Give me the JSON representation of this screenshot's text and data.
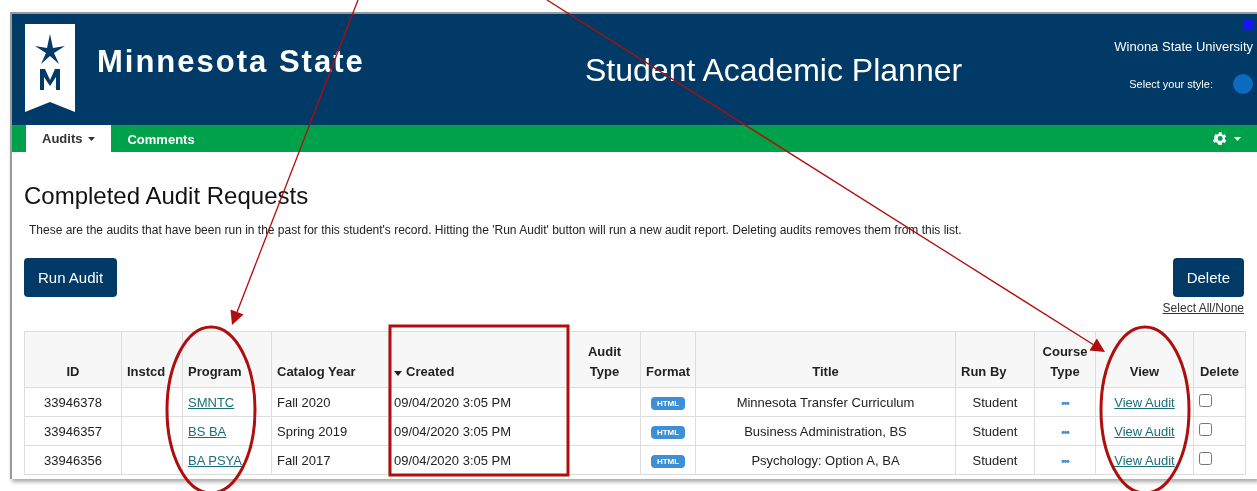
{
  "header": {
    "brand": "Minnesota State",
    "app_title": "Student Academic Planner",
    "institution": "Winona State University",
    "style_label": "Select your style:"
  },
  "nav": {
    "tabs": [
      {
        "label": "Audits",
        "selected": true,
        "dropdown": true
      },
      {
        "label": "Comments",
        "selected": false,
        "dropdown": false
      }
    ]
  },
  "page": {
    "title": "Completed Audit Requests",
    "description": "These are the audits that have been run in the past for this student's record. Hitting the 'Run Audit' button will run a new audit report. Deleting audits removes them from this list.",
    "run_button": "Run Audit",
    "delete_button": "Delete",
    "select_all_link": "Select All/None"
  },
  "table": {
    "columns": [
      {
        "label": "ID",
        "sorted": false
      },
      {
        "label": "Instcd",
        "sorted": false
      },
      {
        "label": "Program",
        "sorted": false
      },
      {
        "label": "Catalog Year",
        "sorted": false
      },
      {
        "label": "Created",
        "sorted": true
      },
      {
        "label": "Audit Type",
        "sorted": false
      },
      {
        "label": "Format",
        "sorted": false
      },
      {
        "label": "Title",
        "sorted": false
      },
      {
        "label": "Run By",
        "sorted": false
      },
      {
        "label": "Course Type",
        "sorted": false
      },
      {
        "label": "View",
        "sorted": false
      },
      {
        "label": "Delete",
        "sorted": false
      }
    ],
    "rows": [
      {
        "id": "33946378",
        "program": "SMNTC",
        "catalog_year": "Fall 2020",
        "created": "09/04/2020 3:05 PM",
        "format": "HTML",
        "title": "Minnesota Transfer Curriculum",
        "run_by": "Student",
        "course_type": "•••",
        "view": "View Audit",
        "checked": false
      },
      {
        "id": "33946357",
        "program": "BS BA",
        "catalog_year": "Spring 2019",
        "created": "09/04/2020 3:05 PM",
        "format": "HTML",
        "title": "Business Administration, BS",
        "run_by": "Student",
        "course_type": "•••",
        "view": "View Audit",
        "checked": false
      },
      {
        "id": "33946356",
        "program": "BA PSYA",
        "catalog_year": "Fall 2017",
        "created": "09/04/2020 3:05 PM",
        "format": "HTML",
        "title": "Psychology: Option A, BA",
        "run_by": "Student",
        "course_type": "•••",
        "view": "View Audit",
        "checked": false
      }
    ]
  },
  "annotations": [
    {
      "kind": "arrow"
    },
    {
      "kind": "arrow"
    },
    {
      "kind": "oval"
    },
    {
      "kind": "rectangle"
    },
    {
      "kind": "oval"
    }
  ]
}
